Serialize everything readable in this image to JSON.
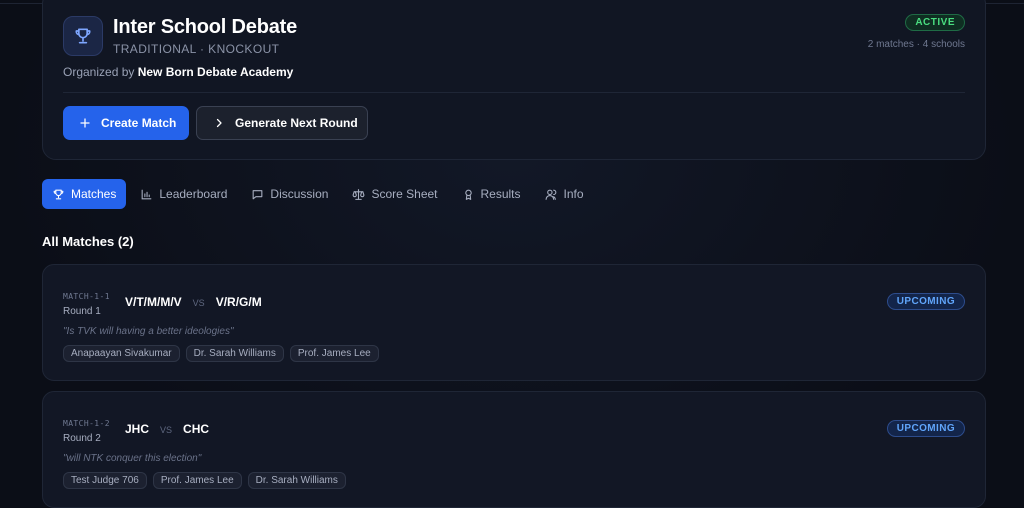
{
  "tournament": {
    "title": "Inter School Debate",
    "subtitle": "TRADITIONAL · KNOCKOUT",
    "organizer_prefix": "Organized by",
    "organizer_name": "New Born Debate Academy",
    "status": "ACTIVE",
    "counts": "2 matches · 4 schools",
    "logo_icon": "trophy-icon"
  },
  "actions": {
    "create_match": "Create Match",
    "generate_next_round": "Generate Next Round"
  },
  "tabs": [
    {
      "label": "Matches",
      "icon": "trophy-icon",
      "active": true
    },
    {
      "label": "Leaderboard",
      "icon": "bar-chart-icon"
    },
    {
      "label": "Discussion",
      "icon": "chat-icon"
    },
    {
      "label": "Score Sheet",
      "icon": "scale-icon"
    },
    {
      "label": "Results",
      "icon": "award-icon"
    },
    {
      "label": "Info",
      "icon": "users-icon"
    }
  ],
  "matches_section": {
    "title": "All Matches (2)"
  },
  "matches": [
    {
      "code": "MATCH-1-1",
      "round": "Round 1",
      "team_a": "V/T/M/M/V",
      "vs": "VS",
      "team_b": "V/R/G/M",
      "motion": "\"Is TVK will having a better ideologies\"",
      "status": "UPCOMING",
      "judges": [
        "Anapaayan Sivakumar",
        "Dr. Sarah Williams",
        "Prof. James Lee"
      ]
    },
    {
      "code": "MATCH-1-2",
      "round": "Round 2",
      "team_a": "JHC",
      "vs": "VS",
      "team_b": "CHC",
      "motion": "\"will NTK conquer this election\"",
      "status": "UPCOMING",
      "judges": [
        "Test Judge 706",
        "Prof. James Lee",
        "Dr. Sarah Williams"
      ]
    }
  ],
  "colors": {
    "accent": "#2563eb",
    "active_badge": "#4ade80",
    "upcoming_badge": "#60a5fa",
    "background": "#0b0e17"
  }
}
